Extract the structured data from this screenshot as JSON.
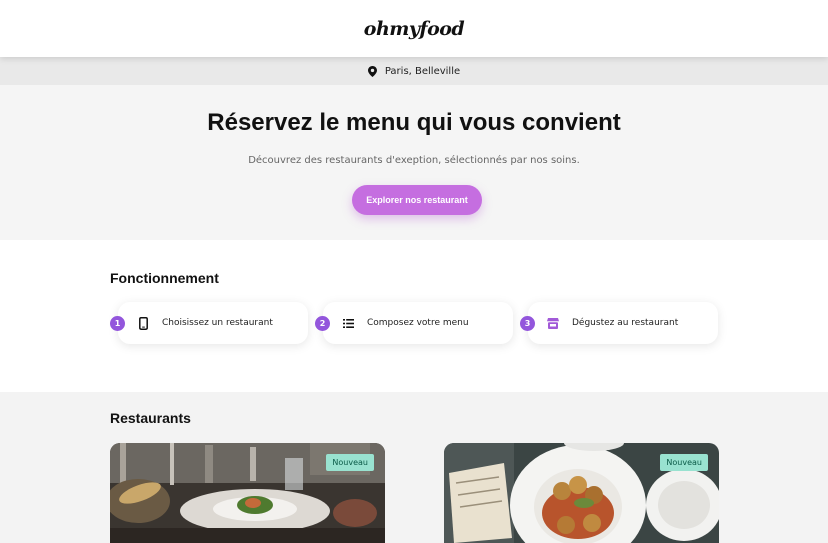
{
  "header": {
    "logo": "ohmyfood"
  },
  "location": {
    "icon": "map-pin-icon",
    "text": "Paris, Belleville"
  },
  "hero": {
    "title": "Réservez le menu qui vous convient",
    "subtitle": "Découvrez des restaurants d'exeption, sélectionnés par nos soins.",
    "cta_label": "Explorer nos restaurant",
    "accent_color": "#c56ee0"
  },
  "how_it_works": {
    "title": "Fonctionnement",
    "steps": [
      {
        "number": "1",
        "icon": "mobile-phone-icon",
        "label": "Choisissez un restaurant"
      },
      {
        "number": "2",
        "icon": "list-icon",
        "label": "Composez votre menu"
      },
      {
        "number": "3",
        "icon": "store-icon",
        "label": "Dégustez au restaurant"
      }
    ],
    "number_color": "#9356dc"
  },
  "restaurants": {
    "title": "Restaurants",
    "cards": [
      {
        "badge": "Nouveau",
        "image": "restaurant-photo-plated-dish"
      },
      {
        "badge": "Nouveau",
        "image": "restaurant-photo-meatballs-plate"
      }
    ],
    "badge_color": "#99e2d0"
  }
}
